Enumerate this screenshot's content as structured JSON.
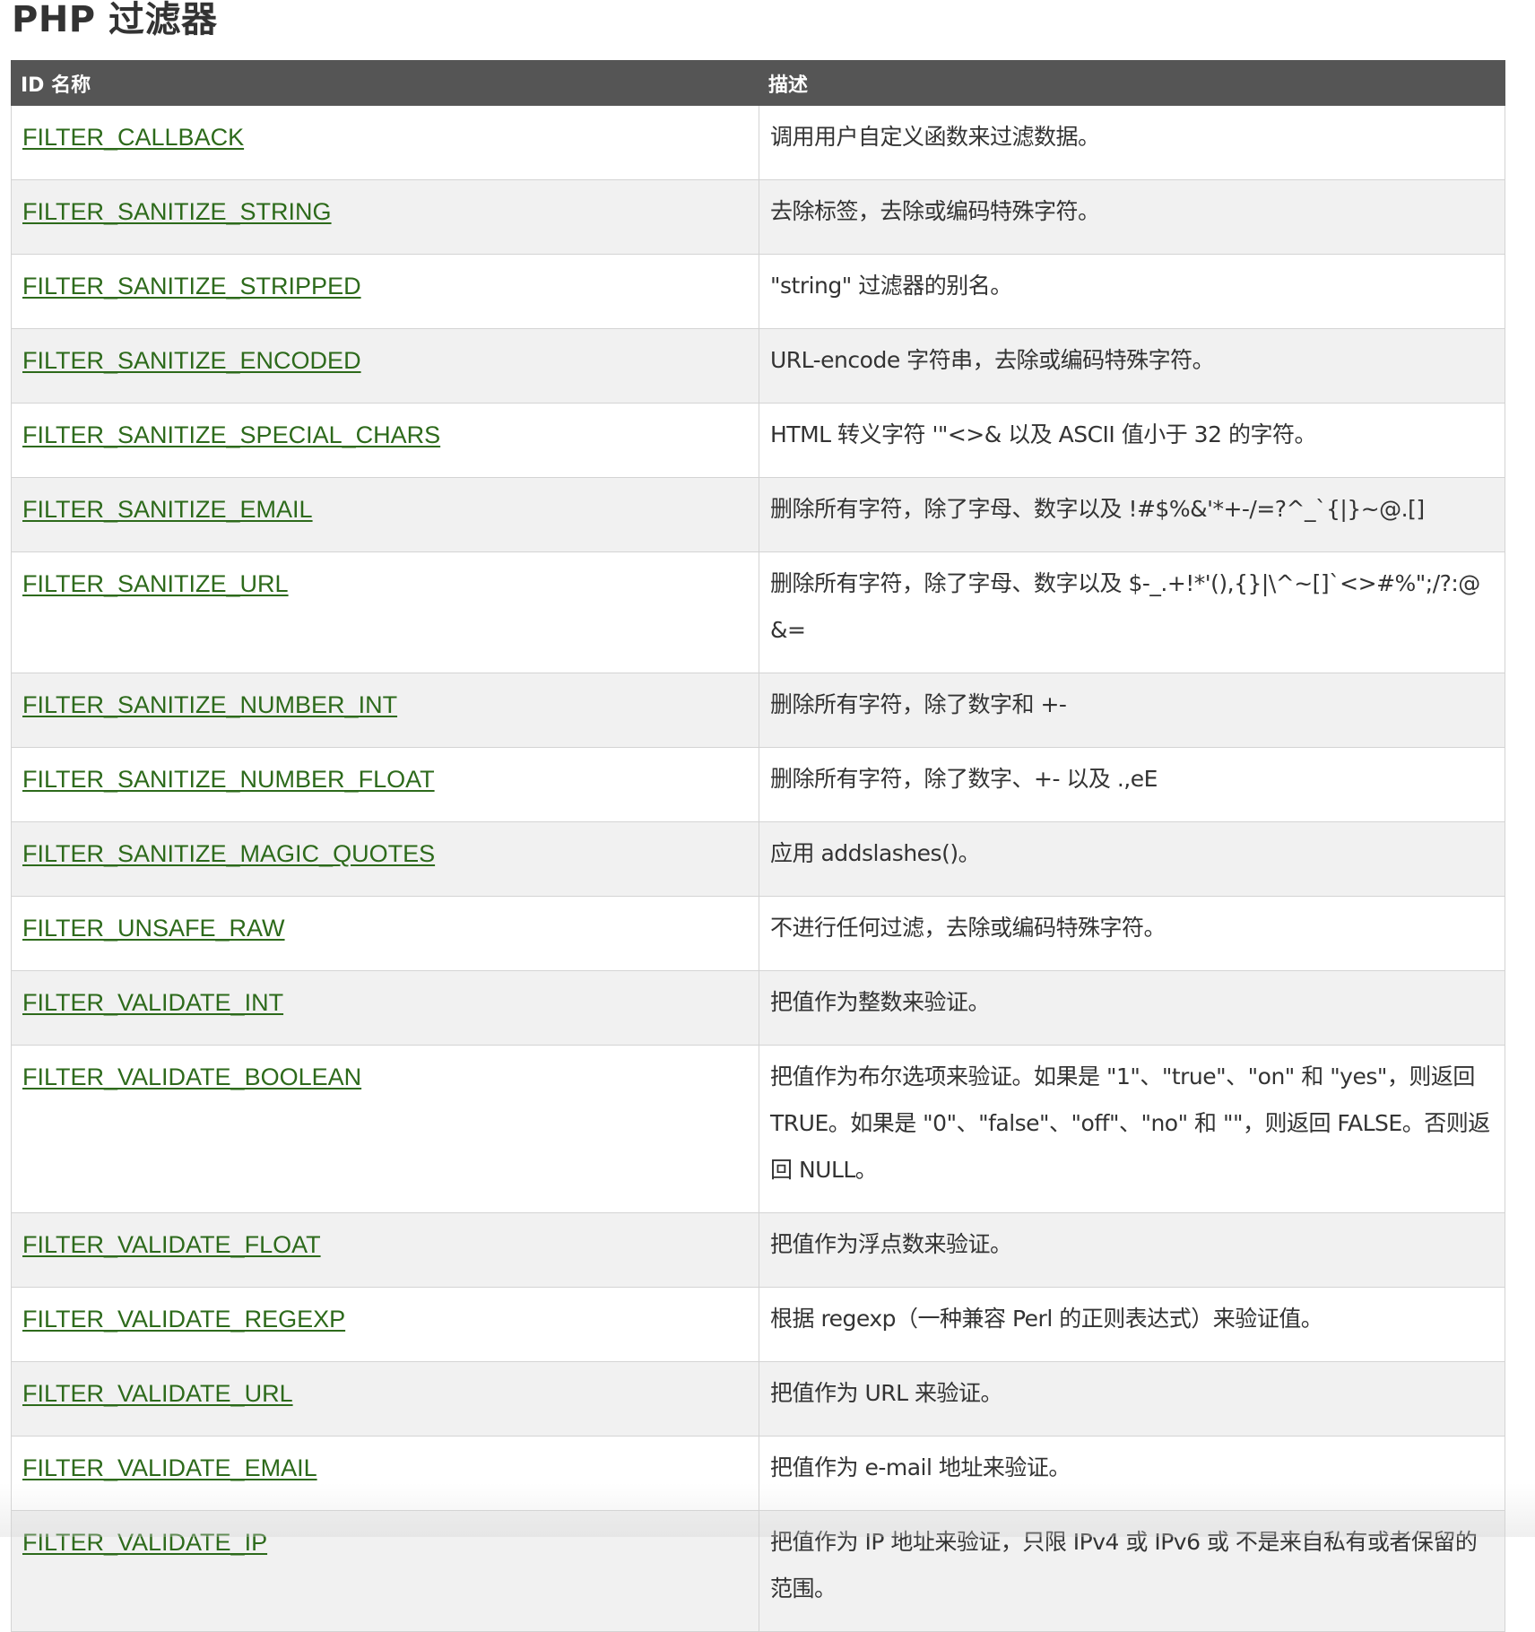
{
  "page": {
    "title": "PHP 过滤器"
  },
  "table": {
    "headers": {
      "name": "ID 名称",
      "description": "描述"
    },
    "rows": [
      {
        "name": "FILTER_CALLBACK",
        "description": "调用用户自定义函数来过滤数据。"
      },
      {
        "name": "FILTER_SANITIZE_STRING",
        "description": "去除标签，去除或编码特殊字符。"
      },
      {
        "name": "FILTER_SANITIZE_STRIPPED",
        "description": "\"string\" 过滤器的别名。"
      },
      {
        "name": "FILTER_SANITIZE_ENCODED",
        "description": "URL-encode 字符串，去除或编码特殊字符。"
      },
      {
        "name": "FILTER_SANITIZE_SPECIAL_CHARS",
        "description": "HTML 转义字符 '\"<>& 以及 ASCII 值小于 32 的字符。"
      },
      {
        "name": "FILTER_SANITIZE_EMAIL",
        "description": "删除所有字符，除了字母、数字以及 !#$%&'*+-/=?^_`{|}~@.[]"
      },
      {
        "name": "FILTER_SANITIZE_URL",
        "description": "删除所有字符，除了字母、数字以及 $-_.+!*'(),{}|\\^~[]`<>#%\";/?:@&="
      },
      {
        "name": "FILTER_SANITIZE_NUMBER_INT",
        "description": "删除所有字符，除了数字和 +-"
      },
      {
        "name": "FILTER_SANITIZE_NUMBER_FLOAT",
        "description": "删除所有字符，除了数字、+- 以及 .,eE"
      },
      {
        "name": "FILTER_SANITIZE_MAGIC_QUOTES",
        "description": "应用 addslashes()。"
      },
      {
        "name": "FILTER_UNSAFE_RAW",
        "description": "不进行任何过滤，去除或编码特殊字符。"
      },
      {
        "name": "FILTER_VALIDATE_INT",
        "description": "把值作为整数来验证。"
      },
      {
        "name": "FILTER_VALIDATE_BOOLEAN",
        "description": "把值作为布尔选项来验证。如果是 \"1\"、\"true\"、\"on\" 和 \"yes\"，则返回 TRUE。如果是 \"0\"、\"false\"、\"off\"、\"no\" 和 \"\"，则返回 FALSE。否则返回 NULL。"
      },
      {
        "name": "FILTER_VALIDATE_FLOAT",
        "description": "把值作为浮点数来验证。"
      },
      {
        "name": "FILTER_VALIDATE_REGEXP",
        "description": "根据 regexp（一种兼容 Perl 的正则表达式）来验证值。"
      },
      {
        "name": "FILTER_VALIDATE_URL",
        "description": "把值作为 URL 来验证。"
      },
      {
        "name": "FILTER_VALIDATE_EMAIL",
        "description": "把值作为 e-mail 地址来验证。"
      },
      {
        "name": "FILTER_VALIDATE_IP",
        "description": "把值作为 IP 地址来验证，只限 IPv4 或 IPv6 或 不是来自私有或者保留的范围。"
      }
    ]
  },
  "colors": {
    "header_bg": "#555555",
    "link": "#2d6a1b",
    "stripe": "#f1f1f1",
    "border": "#d4d4d4"
  }
}
